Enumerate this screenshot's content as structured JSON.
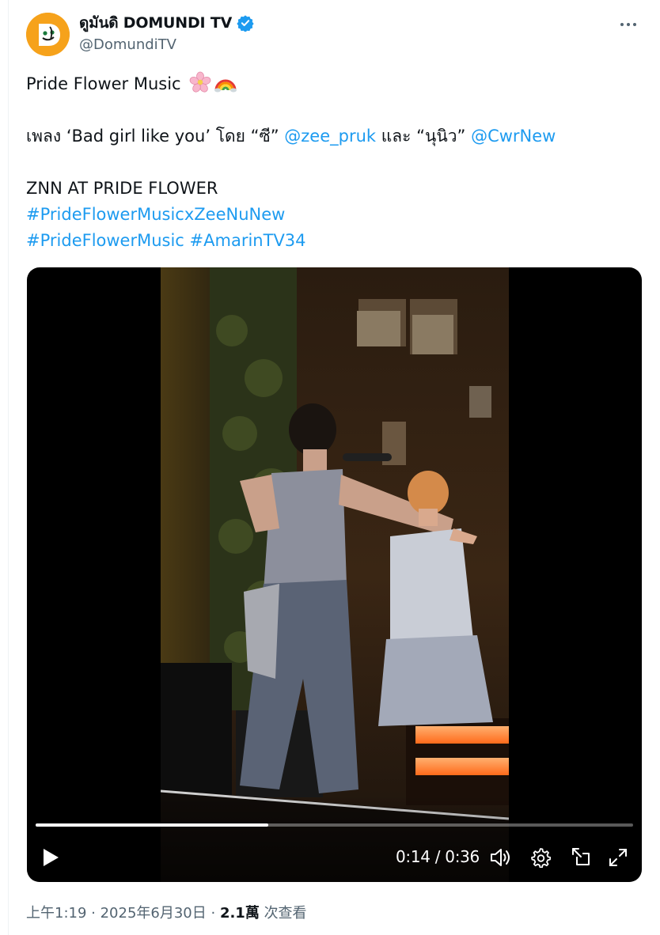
{
  "author": {
    "display_name": "ดูมันดิ DOMUNDI TV",
    "handle": "@DomundiTV",
    "verified": true,
    "avatar_bg": "#f6a21b"
  },
  "tweet": {
    "line1": "Pride Flower Music",
    "line1_emojis": [
      "cherry-blossom",
      "rainbow"
    ],
    "line2_prefix": "เพลง ‘Bad girl like you’ โดย “ซี” ",
    "mention1": "@zee_pruk",
    "line2_middle": " และ “นุนิว” ",
    "mention2": "@CwrNew",
    "line3": "ZNN AT PRIDE FLOWER",
    "hashtag1": "#PrideFlowerMusicxZeeNuNew",
    "hashtag2": "#PrideFlowerMusic",
    "hashtag3": "#AmarinTV34"
  },
  "video": {
    "current_time": "0:14",
    "duration": "0:36",
    "time_display": "0:14 / 0:36",
    "progress_fraction": 0.389
  },
  "meta": {
    "time": "上午1:19",
    "date": "2025年6月30日",
    "views_count": "2.1萬",
    "views_label": "次查看"
  },
  "colors": {
    "link": "#1d9bf0",
    "text": "#0f1419",
    "secondary": "#536471"
  }
}
